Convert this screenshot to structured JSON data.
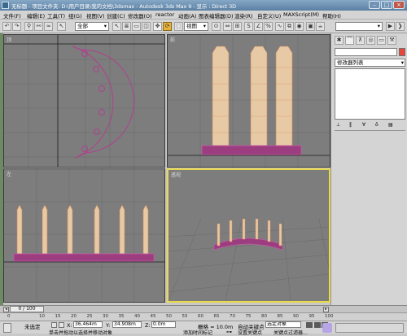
{
  "window": {
    "title": "无标题 - 项目文件夹: D:\\用户目录\\我的文档\\3dsmax - Autodesk 3ds Max 9 - 显示 : Direct 3D"
  },
  "menu": {
    "items": [
      "文件(F)",
      "编辑(E)",
      "工具(T)",
      "组(G)",
      "视图(V)",
      "创建(C)",
      "修改器(O)",
      "reactor",
      "动画(A)",
      "图表编辑器(D)",
      "渲染(R)",
      "自定义(U)",
      "MAXScript(M)",
      "帮助(H)"
    ]
  },
  "toolbar": {
    "selection_filter": "全部",
    "view_dropdown": "视图",
    "selection_set": ""
  },
  "viewports": {
    "top_label": "顶",
    "front_label": "前",
    "left_label": "左",
    "perspective_label": "透视"
  },
  "command_panel": {
    "name_field": "",
    "modifier_list": "修改器列表"
  },
  "timeline": {
    "frame_counter": "0 / 100",
    "ruler_ticks": [
      "0",
      "10",
      "15",
      "20",
      "25",
      "30",
      "35",
      "40",
      "45",
      "50",
      "55",
      "60",
      "65",
      "70",
      "75",
      "80",
      "85",
      "90",
      "95",
      "100"
    ]
  },
  "status": {
    "selection": "未选定",
    "x_label": "X:",
    "x_value": "36.464m",
    "y_label": "Y:",
    "y_value": "34.908m",
    "z_label": "Z:",
    "z_value": "0.0m",
    "grid": "栅格 = 10.0m",
    "auto_key": "自动关键点",
    "set_key": "设置关键点",
    "selected_object": "选定对象",
    "key_filters": "关键点过滤器...",
    "prompt": "单击并拖动以选择并移动对象",
    "add_time_tag": "添加时间标记"
  },
  "colors": {
    "titlebar": "#5b7fa3",
    "viewport_bg": "#7d7d7d",
    "active_border": "#e8d84a",
    "building": "#e8b48a",
    "base": "#b0408e",
    "grid": "#666666"
  }
}
